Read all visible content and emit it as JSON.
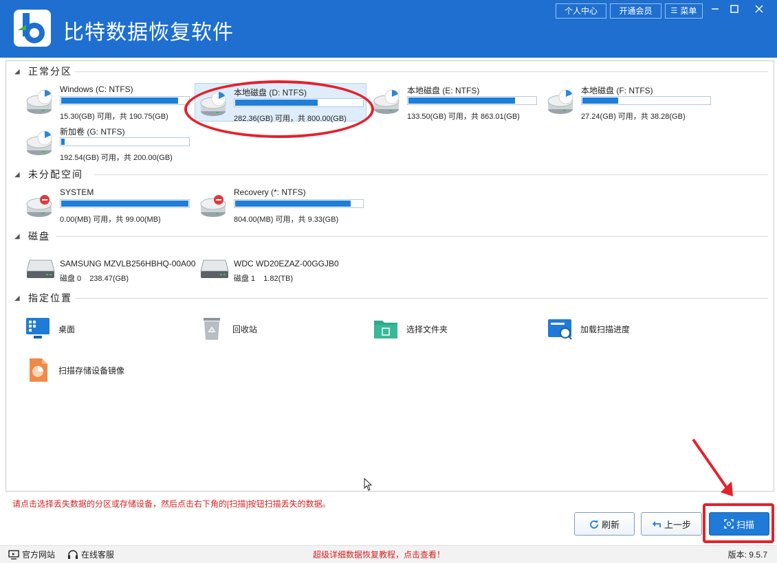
{
  "app": {
    "title": "比特数据恢复软件"
  },
  "titlebar": {
    "personal_center": "个人中心",
    "membership": "开通会员",
    "menu": "菜单",
    "min_icon": "minimize-icon",
    "max_icon": "maximize-icon",
    "close_icon": "close-icon"
  },
  "sections": {
    "normal": "正常分区",
    "unallocated": "未分配空间",
    "disks": "磁盘",
    "locations": "指定位置"
  },
  "partitions": [
    {
      "name": "Windows (C: NTFS)",
      "info": "15.30(GB) 可用，共 190.75(GB)",
      "used": 0.92
    },
    {
      "name": "本地磁盘 (D: NTFS)",
      "info": "282.36(GB) 可用，共 800.00(GB)",
      "used": 0.65
    },
    {
      "name": "本地磁盘 (E: NTFS)",
      "info": "133.50(GB) 可用，共 863.01(GB)",
      "used": 0.84
    },
    {
      "name": "本地磁盘 (F: NTFS)",
      "info": "27.24(GB) 可用，共 38.28(GB)",
      "used": 0.29
    },
    {
      "name": "新加卷 (G: NTFS)",
      "info": "192.54(GB) 可用，共 200.00(GB)",
      "used": 0.04
    }
  ],
  "unallocated": [
    {
      "name": "SYSTEM",
      "info": "0.00(MB) 可用，共 99.00(MB)",
      "used": 1.0
    },
    {
      "name": "Recovery (*: NTFS)",
      "info": "804.00(MB) 可用，共 9.33(GB)",
      "used": 0.91
    }
  ],
  "disks": [
    {
      "name": "SAMSUNG MZVLB256HBHQ-00A00",
      "label": "磁盘 0",
      "size": "238.47(GB)"
    },
    {
      "name": "WDC WD20EZAZ-00GGJB0",
      "label": "磁盘 1",
      "size": "1.82(TB)"
    }
  ],
  "locations": [
    {
      "label": "桌面",
      "icon": "desktop-icon"
    },
    {
      "label": "回收站",
      "icon": "recycle-bin-icon"
    },
    {
      "label": "选择文件夹",
      "icon": "folder-icon"
    },
    {
      "label": "加载扫描进度",
      "icon": "load-progress-icon"
    },
    {
      "label": "扫描存储设备镜像",
      "icon": "disk-image-icon"
    }
  ],
  "hint": "请点击选择丢失数据的分区或存储设备，然后点击右下角的[扫描]按钮扫描丢失的数据。",
  "buttons": {
    "refresh": "刷新",
    "back": "上一步",
    "scan": "扫描"
  },
  "statusbar": {
    "website": "官方网站",
    "support": "在线客服",
    "tutorial": "超级详细数据恢复教程，点击查看！",
    "version": "版本: 9.5.7"
  },
  "colors": {
    "brand": "#1e6fd0",
    "bar_fill": "#1f7fd8",
    "annotation": "#e4212b",
    "hint": "#d42020"
  }
}
